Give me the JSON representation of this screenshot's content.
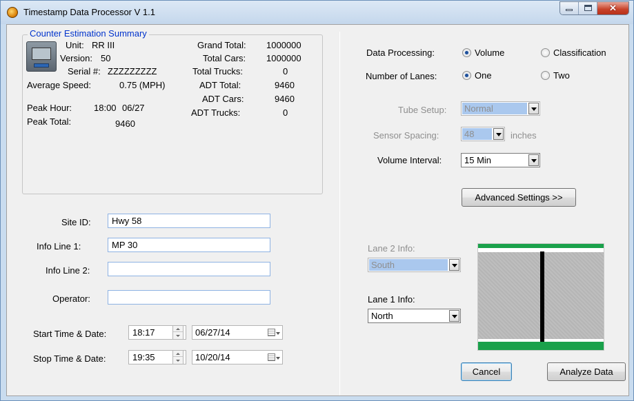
{
  "window": {
    "title": "Timestamp Data Processor V 1.1"
  },
  "summary": {
    "group_title": "Counter Estimation Summary",
    "unit_label": "Unit:",
    "unit_value": "RR III",
    "version_label": "Version:",
    "version_value": "50",
    "serial_label": "Serial #:",
    "serial_value": "ZZZZZZZZZ",
    "avg_speed_label": "Average Speed:",
    "avg_speed_value": "0.75 (MPH)",
    "peak_hour_label": "Peak Hour:",
    "peak_hour_time": "18:00",
    "peak_hour_date": "06/27",
    "peak_total_label": "Peak Total:",
    "peak_total_value": "9460",
    "grand_total_label": "Grand Total:",
    "grand_total_value": "1000000",
    "total_cars_label": "Total Cars:",
    "total_cars_value": "1000000",
    "total_trucks_label": "Total Trucks:",
    "total_trucks_value": "0",
    "adt_total_label": "ADT Total:",
    "adt_total_value": "9460",
    "adt_cars_label": "ADT Cars:",
    "adt_cars_value": "9460",
    "adt_trucks_label": "ADT Trucks:",
    "adt_trucks_value": "0"
  },
  "site": {
    "site_id_label": "Site ID:",
    "site_id_value": "Hwy 58",
    "info1_label": "Info Line 1:",
    "info1_value": "MP 30",
    "info2_label": "Info Line 2:",
    "info2_value": "",
    "operator_label": "Operator:",
    "operator_value": ""
  },
  "times": {
    "start_label": "Start Time & Date:",
    "start_time": "18:17",
    "start_date": "06/27/14",
    "stop_label": "Stop Time & Date:",
    "stop_time": "19:35",
    "stop_date": "10/20/14"
  },
  "processing": {
    "data_processing_label": "Data Processing:",
    "volume_label": "Volume",
    "classification_label": "Classification",
    "selected_processing": "Volume",
    "lanes_label": "Number of Lanes:",
    "one_label": "One",
    "two_label": "Two",
    "selected_lanes": "One",
    "tube_setup_label": "Tube Setup:",
    "tube_setup_value": "Normal",
    "sensor_spacing_label": "Sensor Spacing:",
    "sensor_spacing_value": "48",
    "sensor_spacing_unit": "inches",
    "volume_interval_label": "Volume Interval:",
    "volume_interval_value": "15 Min",
    "advanced_button": "Advanced Settings >>"
  },
  "lanes": {
    "lane2_label": "Lane 2 Info:",
    "lane2_value": "South",
    "lane1_label": "Lane 1 Info:",
    "lane1_value": "North"
  },
  "buttons": {
    "cancel": "Cancel",
    "analyze": "Analyze Data"
  },
  "colors": {
    "group_title": "#0033cc",
    "road_stripe": "#1aa14b",
    "selection": "#aac8ee"
  },
  "icons": {
    "app": "timestamp-app-icon",
    "device": "counter-device-icon",
    "calendar": "calendar-icon"
  }
}
